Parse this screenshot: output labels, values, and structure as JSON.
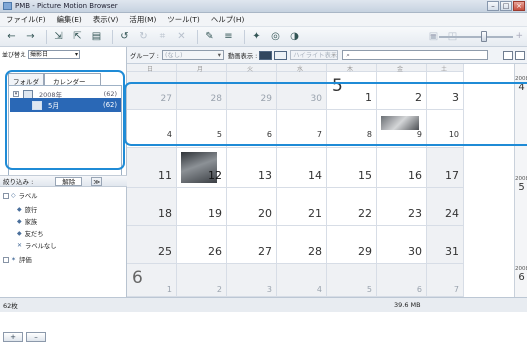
{
  "window": {
    "title": "PMB - Picture Motion Browser",
    "buttons": [
      "–",
      "□",
      "×"
    ]
  },
  "menu": [
    "ファイル(F)",
    "編集(E)",
    "表示(V)",
    "活用(M)",
    "ツール(T)",
    "ヘルプ(H)"
  ],
  "toolbar": {
    "icons": [
      "back-arrow-icon",
      "forward-arrow-icon",
      "import-icon",
      "export-icon",
      "print-icon",
      "rotate-left-icon",
      "rotate-right-icon",
      "delete-icon",
      "info-icon",
      "edit-icon",
      "filter-icon",
      "map-icon",
      "star-icon",
      "share-icon",
      "disc-icon"
    ]
  },
  "sidebar": {
    "sort_label": "並び替え",
    "sort_value": "撮影日",
    "tabs": [
      "フォルダ",
      "カレンダー"
    ],
    "year": {
      "label": "2008年",
      "count": "(62)"
    },
    "month": {
      "label": "5月",
      "count": "(62)"
    },
    "filter_label": "絞り込み :",
    "filter_clear": "解除",
    "filter_toggle": "≫",
    "filters": {
      "labels": "ラベル",
      "trip": "旅行",
      "family": "家族",
      "friends": "友だち",
      "no_label": "ラベルなし",
      "rating": "評価"
    },
    "footer_add": "+",
    "footer_remove": "–"
  },
  "main_bar": {
    "group_label": "グループ :",
    "group_value": "(なし)",
    "movie_label": "動画表示 :",
    "highlight_value": "ハイライト表示",
    "search_placeholder": ""
  },
  "calendar": {
    "weekdays": [
      "日",
      "月",
      "火",
      "水",
      "木",
      "金",
      "土"
    ],
    "rows": [
      {
        "days": [
          "27",
          "28",
          "29",
          "30",
          "1",
          "2",
          "3"
        ],
        "big": "5"
      },
      {
        "days": [
          "4",
          "5",
          "6",
          "7",
          "8",
          "9",
          "10"
        ]
      },
      {
        "days": [
          "11",
          "12",
          "13",
          "14",
          "15",
          "16",
          "17"
        ]
      },
      {
        "days": [
          "18",
          "19",
          "20",
          "21",
          "22",
          "23",
          "24"
        ]
      },
      {
        "days": [
          "25",
          "26",
          "27",
          "28",
          "29",
          "30",
          "31"
        ]
      },
      {
        "days": [
          "1",
          "2",
          "3",
          "4",
          "5",
          "6",
          "7"
        ],
        "big": "6"
      }
    ]
  },
  "week_labels": [
    {
      "year": "2008",
      "month": "4"
    },
    {
      "year": "2008",
      "month": "5"
    },
    {
      "year": "2008",
      "month": "6"
    }
  ],
  "status": {
    "count": "62枚",
    "size": "39.6 MB"
  }
}
